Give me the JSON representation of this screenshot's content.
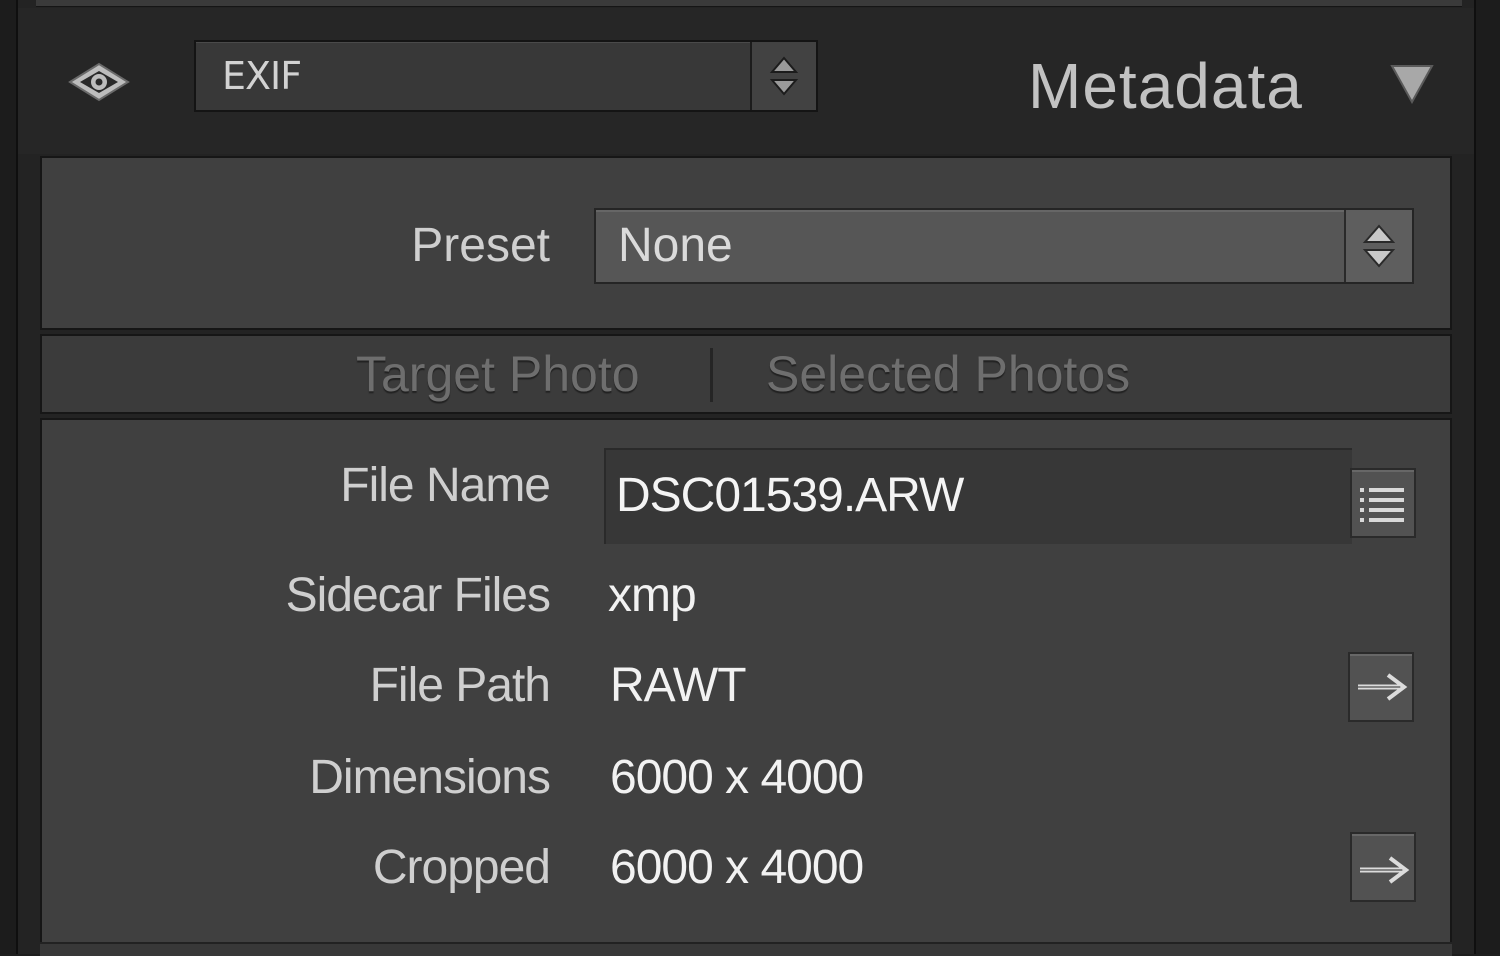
{
  "header": {
    "metadata_set": "EXIF",
    "panel_title": "Metadata",
    "icons": {
      "visibility": "eye-icon",
      "set_stepper": "up-down-arrows-icon",
      "collapse": "triangle-down-icon"
    }
  },
  "preset": {
    "label": "Preset",
    "value": "None"
  },
  "target": {
    "target_photo": "Target Photo",
    "selected_photos": "Selected Photos"
  },
  "fields": [
    {
      "label": "File Name",
      "value": "DSC01539.ARW"
    },
    {
      "label": "Sidecar Files",
      "value": "xmp"
    },
    {
      "label": "File Path",
      "value": "RAWT"
    },
    {
      "label": "Dimensions",
      "value": "6000 x 4000"
    },
    {
      "label": "Cropped",
      "value": "6000 x 4000"
    }
  ],
  "colors": {
    "panel_bg": "#404040",
    "header_bg": "#262626",
    "value_text": "#f2f2f2",
    "label_text": "#cfcfcf",
    "disabled_text": "#6e6e6e"
  }
}
